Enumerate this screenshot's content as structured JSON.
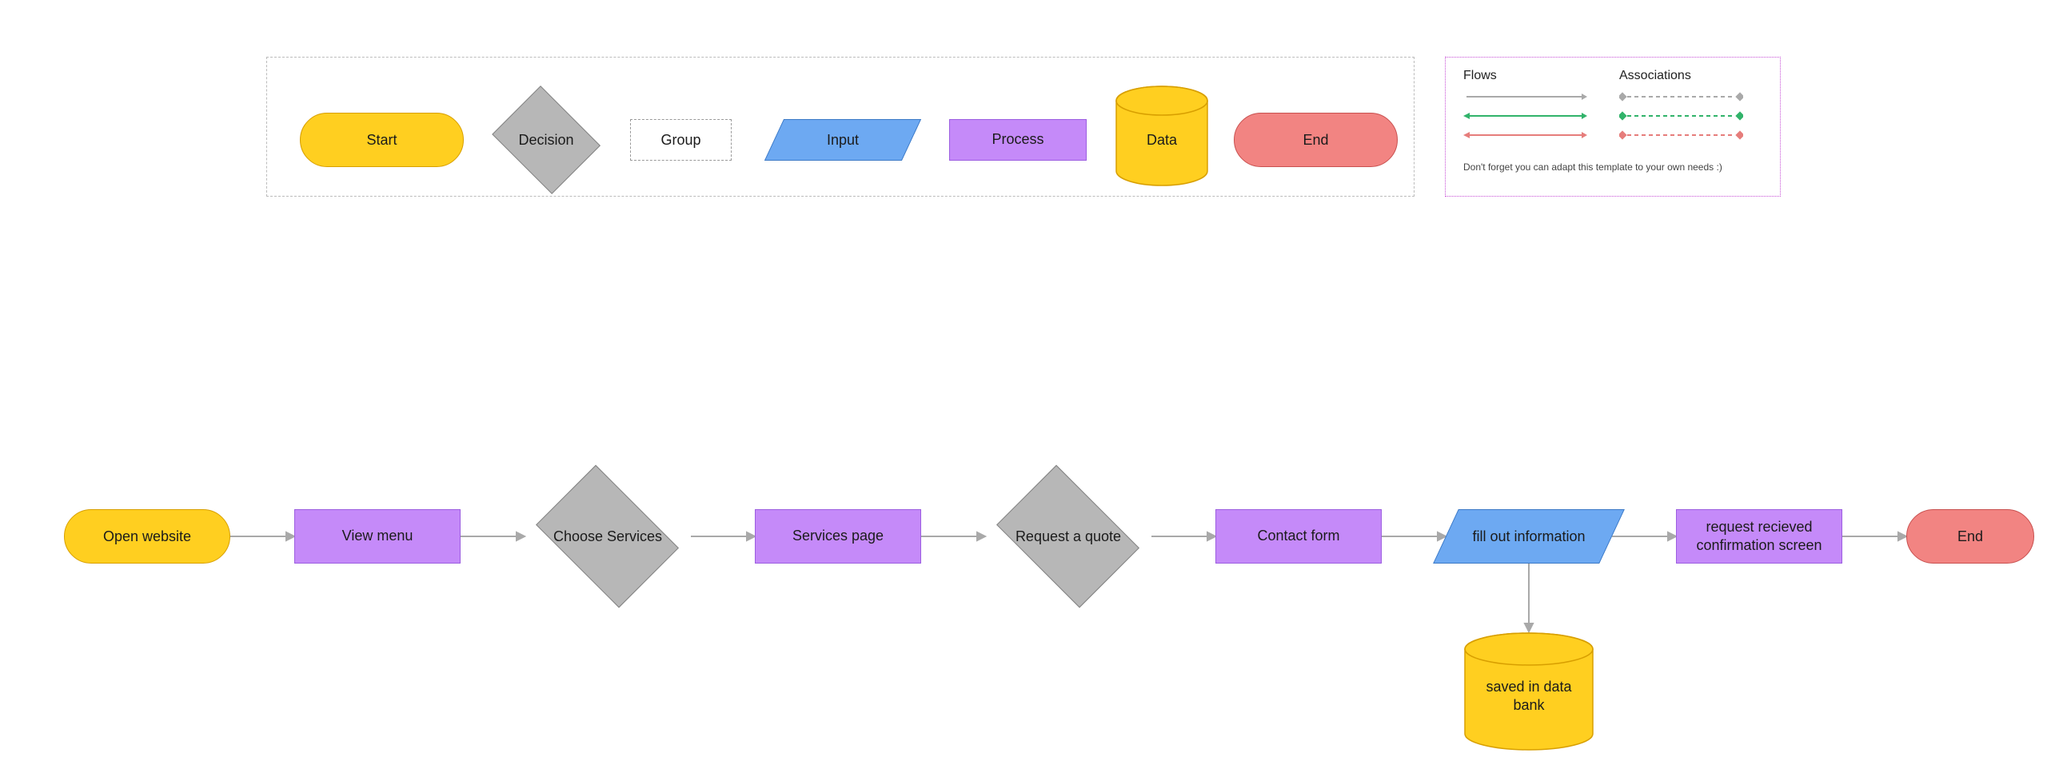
{
  "legend": {
    "shapes": {
      "start": "Start",
      "decision": "Decision",
      "group": "Group",
      "input": "Input",
      "process": "Process",
      "data": "Data",
      "end": "End"
    },
    "flowsTitle": "Flows",
    "assocTitle": "Associations",
    "tip": "Don't forget you can adapt this template to your own needs :)"
  },
  "flow": {
    "n1": "Open website",
    "n2": "View menu",
    "n3": "Choose Services",
    "n4": "Services page",
    "n5": "Request a quote",
    "n6": "Contact form",
    "n7": "fill out information",
    "n8": "request recieved confirmation screen",
    "n9": "End",
    "n10": "saved in data bank"
  }
}
